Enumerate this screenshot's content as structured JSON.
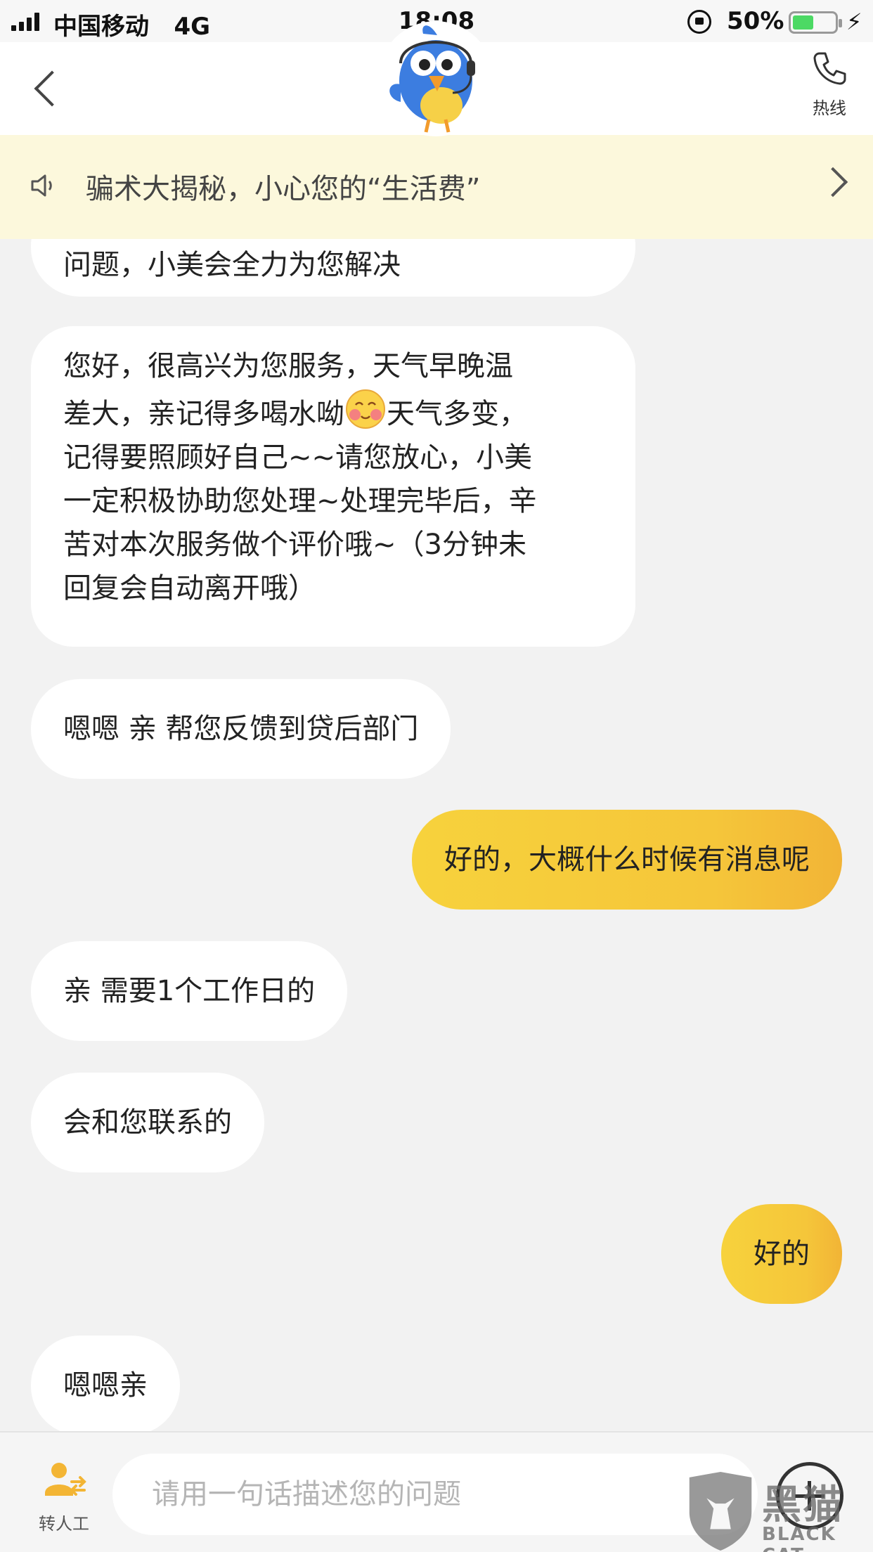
{
  "status_bar": {
    "carrier": "中国移动",
    "network": "4G",
    "time": "18:08",
    "battery_percent": "50%",
    "battery_level": 0.5
  },
  "nav": {
    "hotline_label": "热线"
  },
  "notice": {
    "text": "骗术大揭秘，小心您的“生活费”"
  },
  "messages": [
    {
      "side": "left",
      "lines": [
        "问题，小美会全力为您解决"
      ]
    },
    {
      "side": "left",
      "lines": [
        "您好，很高兴为您服务，天气早晚温",
        "差大，亲记得多喝水呦",
        "天气多变，",
        "记得要照顾好自己~~请您放心，小美",
        "一定积极协助您处理~处理完毕后，辛",
        "苦对本次服务做个评价哦~（3分钟未",
        "回复会自动离开哦）"
      ]
    },
    {
      "side": "left",
      "lines": [
        "嗯嗯 亲 帮您反馈到贷后部门"
      ]
    },
    {
      "side": "right",
      "lines": [
        "好的，大概什么时候有消息呢"
      ]
    },
    {
      "side": "left",
      "lines": [
        "亲 需要1个工作日的"
      ]
    },
    {
      "side": "left",
      "lines": [
        "会和您联系的"
      ]
    },
    {
      "side": "right",
      "lines": [
        "好的"
      ]
    },
    {
      "side": "left",
      "lines": [
        "嗯嗯亲"
      ]
    }
  ],
  "input_bar": {
    "transfer_label": "转人工",
    "placeholder": "请用一句话描述您的问题"
  },
  "watermark": {
    "cn": "黑猫",
    "en": "BLACK CAT"
  },
  "colors": {
    "accent_yellow": "#f5c63a",
    "notice_bg": "#fcf8dc",
    "chat_bg": "#f2f2f2"
  }
}
